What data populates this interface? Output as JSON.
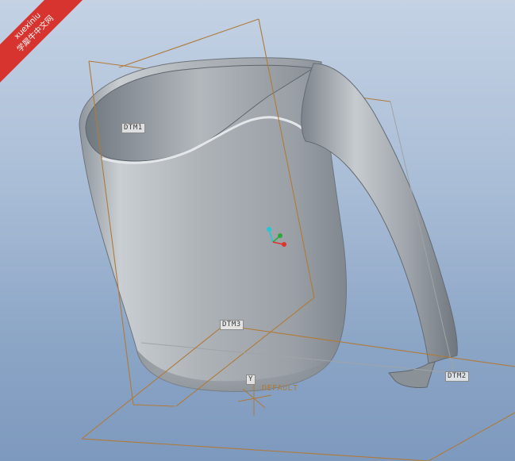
{
  "watermark": {
    "line1": "xuexiniu",
    "line2": "学犀牛中文网"
  },
  "datums": {
    "dtm1": "DTM1",
    "dtm2": "DTM2",
    "dtm3": "DTM3",
    "csys": "DEFAULT",
    "point": "Y"
  },
  "colors": {
    "background_top": "#c4d2e4",
    "background_bottom": "#7d99bd",
    "datum_plane": "#b07a3a",
    "model_surface": "#a7adb3",
    "axis_x": "#e0312a",
    "axis_y": "#2ea83a",
    "axis_z": "#22c7d8",
    "watermark": "#d8342f"
  }
}
